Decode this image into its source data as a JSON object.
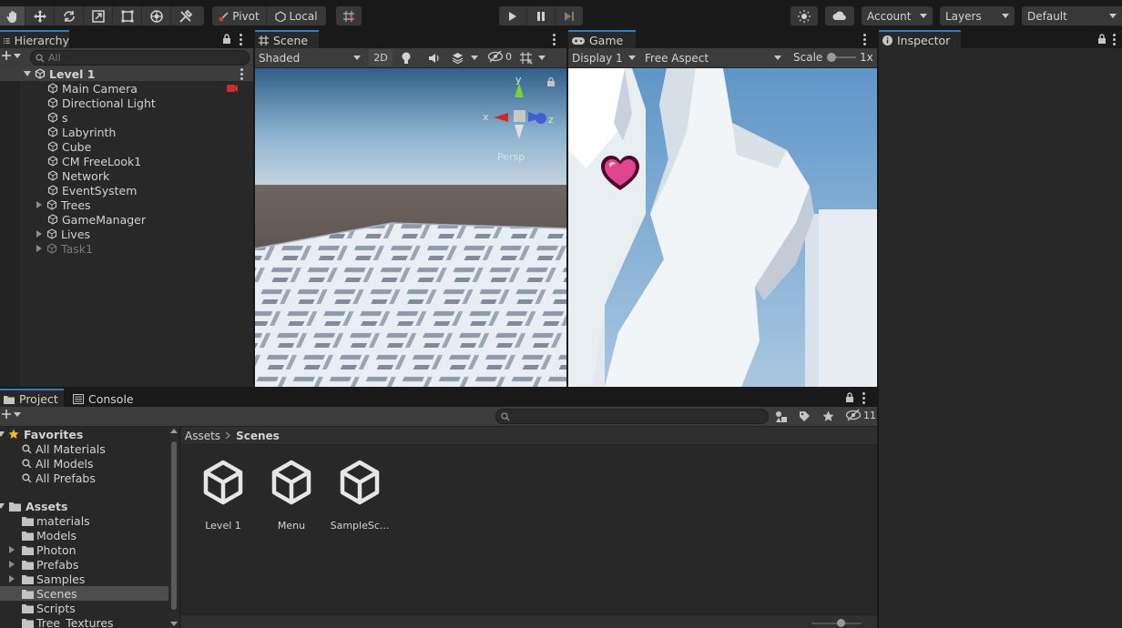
{
  "toolbar": {
    "pivot_label": "Pivot",
    "local_label": "Local",
    "account_label": "Account",
    "layers_label": "Layers",
    "layout_label": "Default"
  },
  "hierarchy": {
    "tab_label": "Hierarchy",
    "search_placeholder": "All",
    "scene_name": "Level 1",
    "items": [
      {
        "label": "Main Camera",
        "expandable": false,
        "dimmed": false
      },
      {
        "label": "Directional Light",
        "expandable": false,
        "dimmed": false
      },
      {
        "label": "s",
        "expandable": false,
        "dimmed": false
      },
      {
        "label": "Labyrinth",
        "expandable": false,
        "dimmed": false
      },
      {
        "label": "Cube",
        "expandable": false,
        "dimmed": false
      },
      {
        "label": "CM FreeLook1",
        "expandable": false,
        "dimmed": false
      },
      {
        "label": "Network",
        "expandable": false,
        "dimmed": false
      },
      {
        "label": "EventSystem",
        "expandable": false,
        "dimmed": false
      },
      {
        "label": "Trees",
        "expandable": true,
        "dimmed": false
      },
      {
        "label": "GameManager",
        "expandable": false,
        "dimmed": false
      },
      {
        "label": "Lives",
        "expandable": true,
        "dimmed": false
      },
      {
        "label": "Task1",
        "expandable": true,
        "dimmed": true
      }
    ]
  },
  "scene": {
    "tab_label": "Scene",
    "shading_mode": "Shaded",
    "mode_2d": "2D",
    "hidden_count": "0",
    "gizmo_axes": {
      "x": "x",
      "y": "y",
      "z": "z"
    },
    "persp_label": "Persp"
  },
  "game": {
    "tab_label": "Game",
    "display": "Display 1",
    "aspect": "Free Aspect",
    "scale_label": "Scale",
    "scale_value": "1x"
  },
  "inspector": {
    "tab_label": "Inspector"
  },
  "project": {
    "tab_label": "Project",
    "console_label": "Console",
    "hidden_count": "11",
    "favorites_label": "Favorites",
    "favorites": [
      "All Materials",
      "All Models",
      "All Prefabs"
    ],
    "assets_label": "Assets",
    "folders": [
      {
        "label": "materials",
        "expandable": false,
        "selected": false
      },
      {
        "label": "Models",
        "expandable": false,
        "selected": false
      },
      {
        "label": "Photon",
        "expandable": true,
        "selected": false
      },
      {
        "label": "Prefabs",
        "expandable": true,
        "selected": false
      },
      {
        "label": "Samples",
        "expandable": true,
        "selected": false
      },
      {
        "label": "Scenes",
        "expandable": false,
        "selected": true
      },
      {
        "label": "Scripts",
        "expandable": false,
        "selected": false
      },
      {
        "label": "Tree_Textures",
        "expandable": false,
        "selected": false
      }
    ],
    "breadcrumb": [
      "Assets",
      "Scenes"
    ],
    "grid_items": [
      "Level 1",
      "Menu",
      "SampleSc..."
    ]
  },
  "colors": {
    "accent": "#3a79bb",
    "panel_bg": "#282828",
    "window_bg": "#191919",
    "selection": "#4d4d4d",
    "heart": "#e0458f"
  }
}
